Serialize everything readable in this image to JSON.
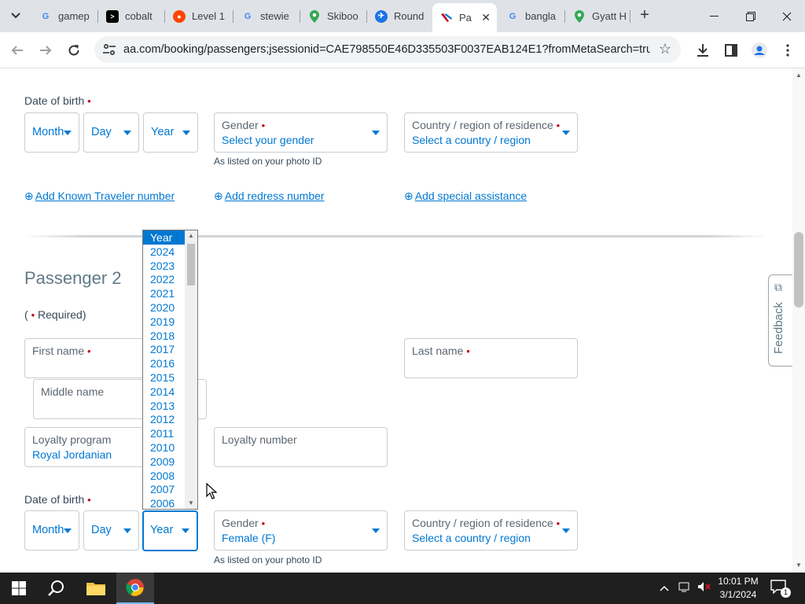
{
  "browser": {
    "tabs": [
      {
        "title": "gamep",
        "icon": "google-icon"
      },
      {
        "title": "cobalt",
        "icon": "terminal-icon"
      },
      {
        "title": "Level 1",
        "icon": "reddit-icon"
      },
      {
        "title": "stewie",
        "icon": "google-icon"
      },
      {
        "title": "Skiboo",
        "icon": "maps-pin-icon"
      },
      {
        "title": "Round",
        "icon": "plane-icon"
      },
      {
        "title": "Pa",
        "icon": "aa-logo-icon",
        "active": true
      },
      {
        "title": "bangla",
        "icon": "google-icon"
      },
      {
        "title": "Gyatt H",
        "icon": "maps-pin-icon"
      }
    ],
    "url": "aa.com/booking/passengers;jsessionid=CAE798550E46D335503F0037EAB124E1?fromMetaSearch=true&b..."
  },
  "passenger1": {
    "dob_label": "Date of birth",
    "month": "Month",
    "day": "Day",
    "year": "Year",
    "gender_label": "Gender",
    "gender_value": "Select your gender",
    "gender_hint": "As listed on your photo ID",
    "country_label": "Country / region of residence",
    "country_value": "Select a country / region",
    "links": {
      "known_traveler": "Add Known Traveler number",
      "redress": "Add redress number",
      "special_assistance": "Add special assistance"
    }
  },
  "passenger2": {
    "heading": "Passenger 2",
    "required_note_open": "(",
    "required_note_text": "Required)",
    "first_name_label": "First name",
    "middle_name_label": "Middle name",
    "last_name_label": "Last name",
    "loyalty_program_label": "Loyalty program",
    "loyalty_program_value": "Royal Jordanian",
    "loyalty_number_label": "Loyalty number",
    "dob_label": "Date of birth",
    "month": "Month",
    "day": "Day",
    "year": "Year",
    "gender_label": "Gender",
    "gender_value": "Female (F)",
    "gender_hint": "As listed on your photo ID",
    "country_label": "Country / region of residence",
    "country_value": "Select a country / region"
  },
  "year_dropdown": {
    "options": [
      "Year",
      "2024",
      "2023",
      "2022",
      "2021",
      "2020",
      "2019",
      "2018",
      "2017",
      "2016",
      "2015",
      "2014",
      "2013",
      "2012",
      "2011",
      "2010",
      "2009",
      "2008",
      "2007",
      "2006"
    ],
    "highlighted": "Year"
  },
  "feedback_tab": "Feedback",
  "required_marker": "•",
  "taskbar": {
    "time": "10:01 PM",
    "date": "3/1/2024",
    "notifications": "1"
  },
  "colors": {
    "link_blue": "#0078d2",
    "required_red": "#c30019",
    "text": "#36495a"
  }
}
